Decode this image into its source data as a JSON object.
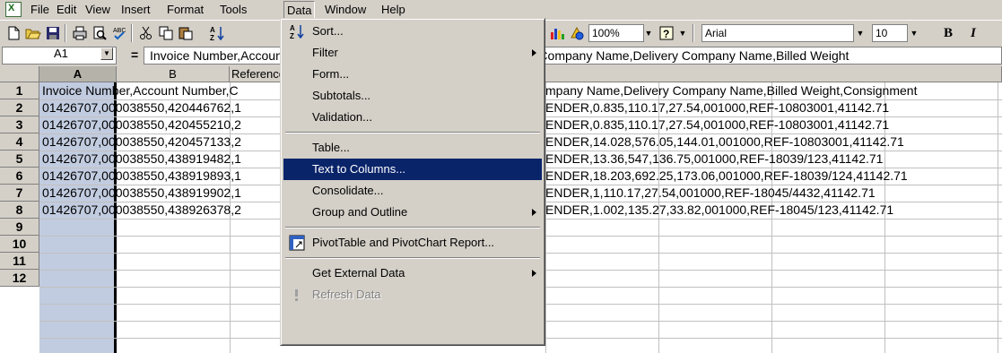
{
  "menubar": {
    "items": [
      "File",
      "Edit",
      "View",
      "Insert",
      "Format",
      "Tools",
      "Data",
      "Window",
      "Help"
    ],
    "active": "Data"
  },
  "toolbar": {
    "zoom": "100%",
    "font": "Arial",
    "size": "10",
    "bold": "B",
    "italic": "I"
  },
  "formula_bar": {
    "name_box": "A1",
    "equals": "=",
    "formula": "Invoice Number,Account Number,Consignment Number,Pick Up Date,Company Name,Delivery Company Name,Billed Weight"
  },
  "grid": {
    "columns": [
      "A",
      "B"
    ],
    "column_c_fragment": "Referenc",
    "rows": [
      "1",
      "2",
      "3",
      "4",
      "5",
      "6",
      "7",
      "8",
      "9",
      "10",
      "11",
      "12"
    ],
    "b1_header": "Reference",
    "cells_left": [
      "Invoice Number,Account Number,C",
      "01426707,000038550,420446762,1",
      "01426707,000038550,420455210,2",
      "01426707,000038550,420457133,2",
      "01426707,000038550,438919482,1",
      "01426707,000038550,438919893,1",
      "01426707,000038550,438919902,1",
      "01426707,000038550,438926378,2"
    ],
    "cells_right": [
      "mpany Name,Delivery Company Name,Billed Weight,Consignment",
      "ENDER,0.835,110.17,27.54,001000,REF-10803001,41142.71",
      "ENDER,0.835,110.17,27.54,001000,REF-10803001,41142.71",
      "ENDER,14.028,576.05,144.01,001000,REF-10803001,41142.71",
      "ENDER,13.36,547,136.75,001000,REF-18039/123,41142.71",
      "ENDER,18.203,692.25,173.06,001000,REF-18039/124,41142.71",
      "ENDER,1,110.17,27.54,001000,REF-18045/4432,41142.71",
      "ENDER,1.002,135.27,33.82,001000,REF-18045/123,41142.71"
    ]
  },
  "data_menu": {
    "items": [
      {
        "label": "Sort...",
        "submenu": false
      },
      {
        "label": "Filter",
        "submenu": true
      },
      {
        "label": "Form...",
        "submenu": false
      },
      {
        "label": "Subtotals...",
        "submenu": false
      },
      {
        "label": "Validation...",
        "submenu": false
      },
      {
        "label": "Table...",
        "submenu": false
      },
      {
        "label": "Text to Columns...",
        "submenu": false,
        "highlighted": true
      },
      {
        "label": "Consolidate...",
        "submenu": false
      },
      {
        "label": "Group and Outline",
        "submenu": true
      },
      {
        "label": "PivotTable and PivotChart Report...",
        "submenu": false
      },
      {
        "label": "Get External Data",
        "submenu": true
      },
      {
        "label": "Refresh Data",
        "submenu": false,
        "disabled": true
      }
    ],
    "highlight_color": "#0a246a"
  }
}
